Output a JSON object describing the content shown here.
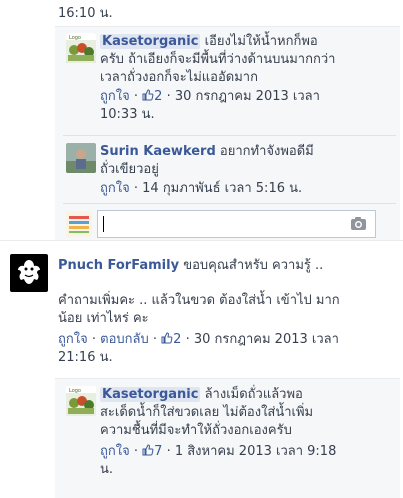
{
  "top_time": "16:10 น.",
  "reply1": {
    "author": "Kasetorganic",
    "text_line1": "เอียงไม่ให้น้ำหกก็พอ",
    "text_line2": "ครับ ถ้าเอียงก็จะมีพื้นที่ว่างด้านบนมากกว่า",
    "text_line3": "เวลาถั่วงอกก็จะไม่แออัดมาก",
    "like": "ถูกใจ",
    "like_count": "2",
    "date_line1": "30 กรกฎาคม 2013 เวลา",
    "date_line2": "10:33 น."
  },
  "reply2": {
    "author": "Surin Kaewkerd",
    "text_line1": "อยากทำจังพอดีมี",
    "text_line2": "ถั่วเขียวอยู่",
    "like": "ถูกใจ",
    "date": "14 กุมภาพันธ์ เวลา 5:16 น."
  },
  "comment": {
    "author": "Pnuch ForFamily",
    "text_line1": "ขอบคุณสำหรับ ความรู้ ..",
    "q_line1": "คำถามเพิ่มคะ .. แล้วในขวด ต้องใส่น้ำ เข้าไป มาก",
    "q_line2": "น้อย เท่าไหร่ คะ",
    "like": "ถูกใจ",
    "reply": "ตอบกลับ",
    "like_count": "2",
    "date_line1": "30 กรกฎาคม 2013 เวลา",
    "date_line2": "21:16 น."
  },
  "reply3": {
    "author": "Kasetorganic",
    "text_line1": "ล้างเม็ดถั่วแล้วพอ",
    "text_line2": "สะเด็ดน้ำก็ใส่ขวดเลย ไม่ต้องใส่น้ำเพิ่ม",
    "text_line3": "ความชื้นที่มีจะทำให้ถั่วงอกเองครับ",
    "like": "ถูกใจ",
    "like_count": "7",
    "date_line1": "1 สิงหาคม 2013 เวลา 9:18",
    "date_line2": "น."
  },
  "separator": "·",
  "colors": {
    "link": "#3b5998",
    "text": "#37404e",
    "reply_bg": "#f6f7f9",
    "highlight": "#dfe5f1"
  },
  "icons": [
    "thumbs-up-icon",
    "camera-icon"
  ]
}
